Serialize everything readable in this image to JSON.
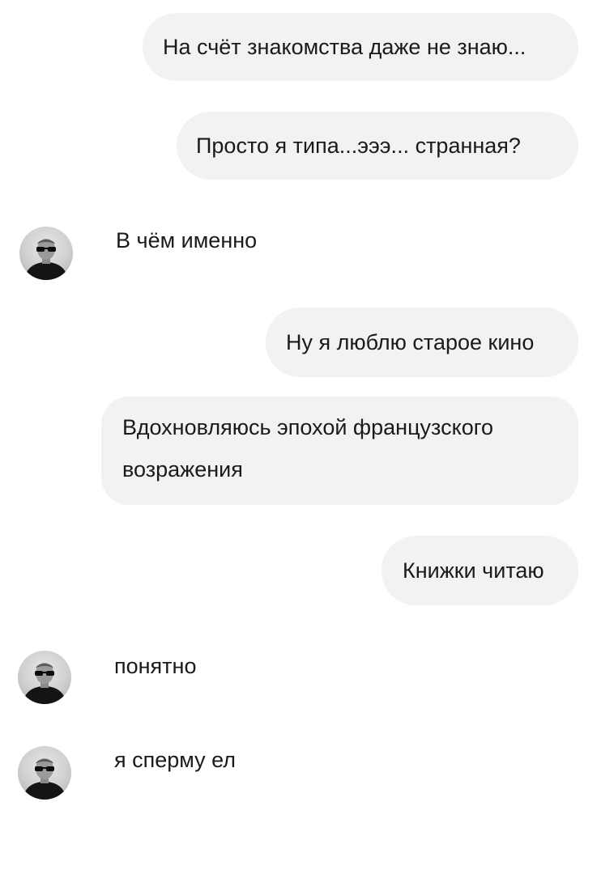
{
  "messages": [
    {
      "side": "outgoing",
      "text": "На счёт знакомства даже не знаю..."
    },
    {
      "side": "outgoing",
      "text": "Просто я типа...эээ... странная?"
    },
    {
      "side": "incoming",
      "text": "В чём именно",
      "avatar": "avatar-man-sunglasses-icon"
    },
    {
      "side": "outgoing",
      "text": "Ну я люблю старое кино"
    },
    {
      "side": "outgoing",
      "text": "Вдохновляюсь эпохой французского возражения"
    },
    {
      "side": "outgoing",
      "text": "Книжки читаю"
    },
    {
      "side": "incoming",
      "text": "понятно",
      "avatar": "avatar-man-sunglasses-icon"
    },
    {
      "side": "incoming",
      "text": "я сперму ел",
      "avatar": "avatar-man-sunglasses-icon"
    }
  ],
  "colors": {
    "bubble_bg": "#f2f2f3",
    "text": "#1a1a1a",
    "background": "#ffffff"
  }
}
